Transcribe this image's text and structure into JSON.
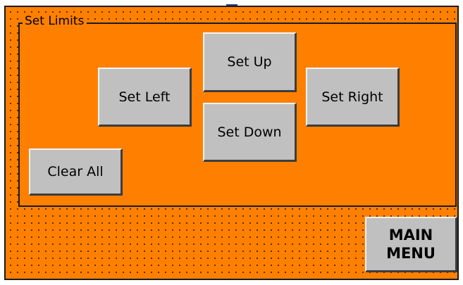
{
  "group": {
    "title": "Set Limits"
  },
  "buttons": {
    "set_up": "Set Up",
    "set_left": "Set Left",
    "set_right": "Set Right",
    "set_down": "Set Down",
    "clear_all": "Clear All",
    "main_menu": "MAIN\nMENU"
  },
  "colors": {
    "panel_background": "#ff8000",
    "button_face": "#c0c0c0",
    "border": "#1a1a1a"
  }
}
